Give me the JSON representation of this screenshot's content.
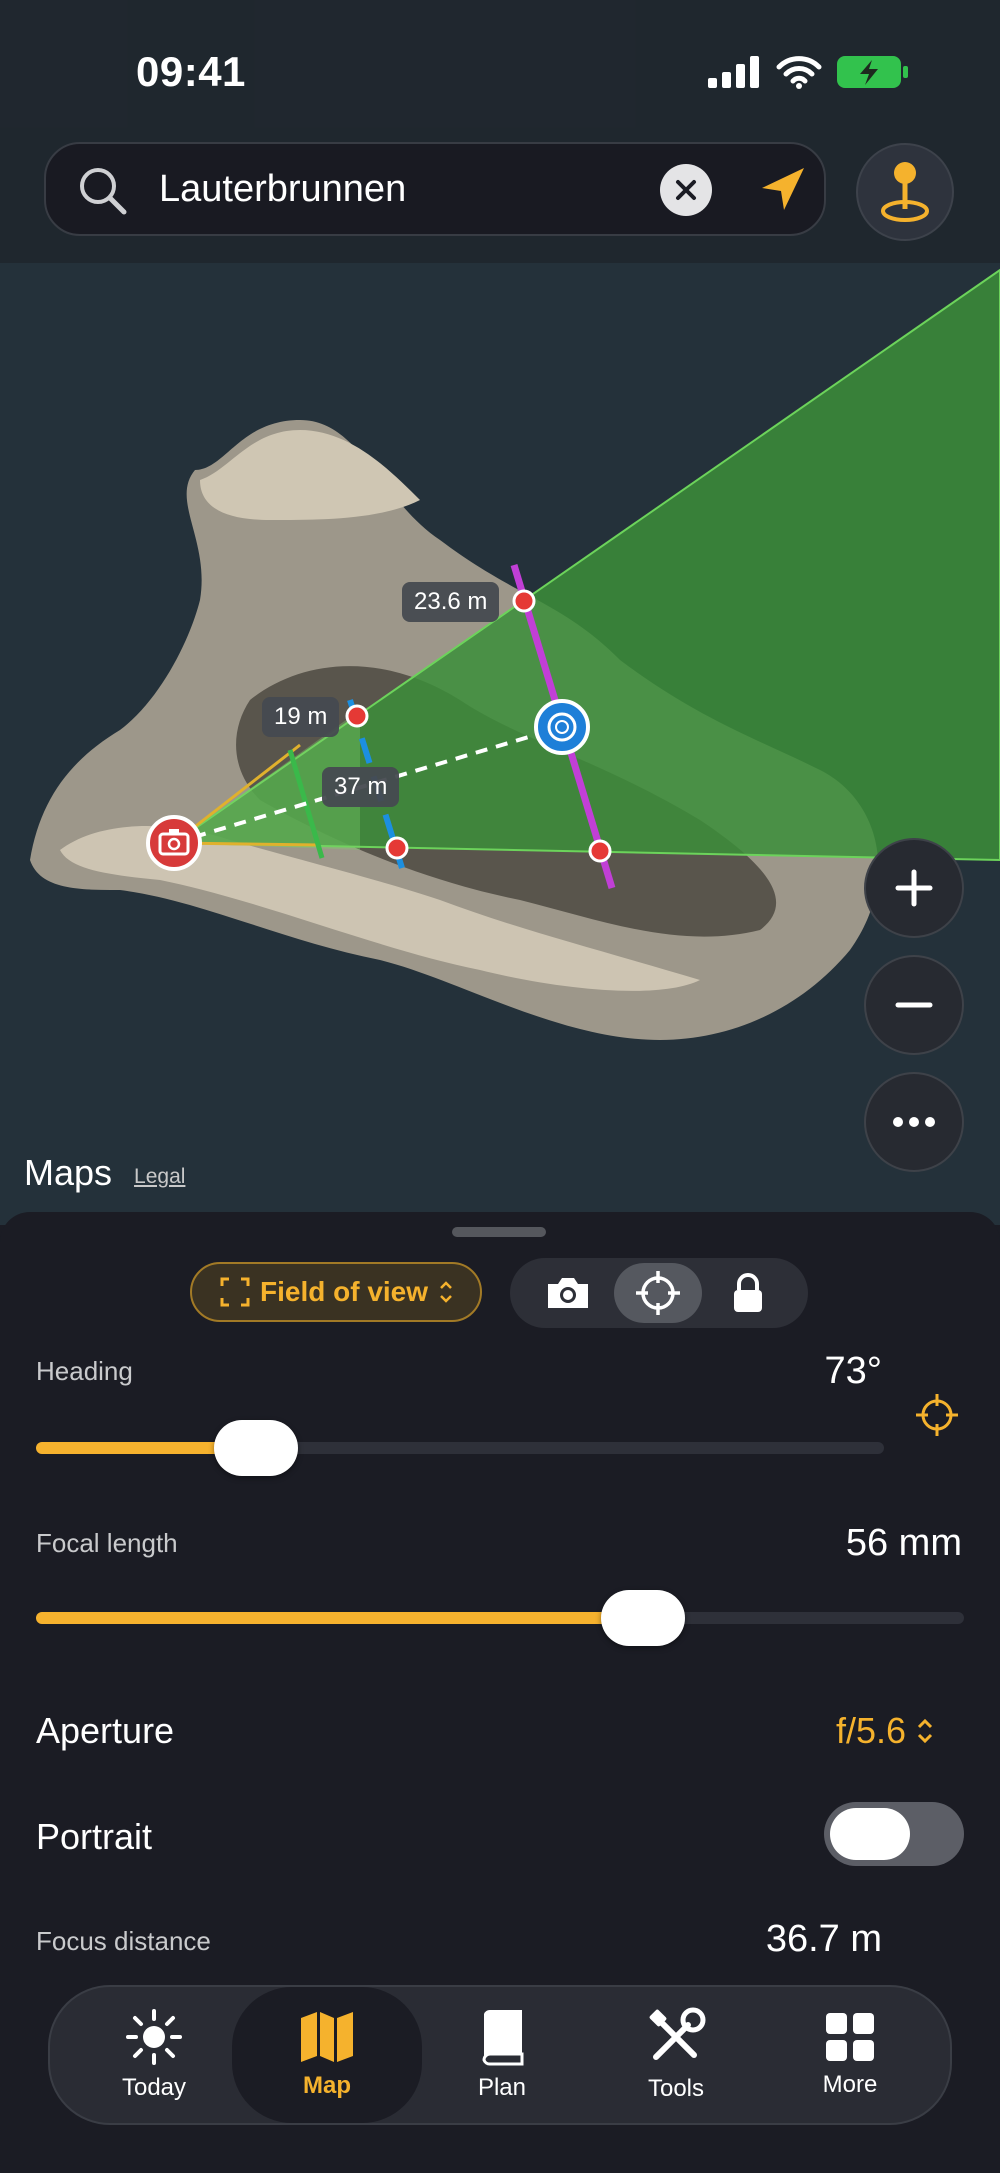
{
  "status_bar": {
    "time": "09:41"
  },
  "search": {
    "query": "Lauterbrunnen"
  },
  "map": {
    "labels": {
      "far": "23.6 m",
      "near": "19 m",
      "subject": "37 m"
    },
    "brand": "Maps",
    "legal": "Legal",
    "colors": {
      "field": "#3c8e3a",
      "accent": "#f5b22d",
      "focus_line": "#c13fd6",
      "dof_line": "#1c8fe0"
    }
  },
  "sheet": {
    "mode_pill": "Field of view",
    "heading": {
      "label": "Heading",
      "value": "73°",
      "fraction": 0.233
    },
    "focal_length": {
      "label": "Focal length",
      "value": "56 mm",
      "fraction": 0.67
    },
    "aperture": {
      "label": "Aperture",
      "value": "f/5.6"
    },
    "portrait": {
      "label": "Portrait",
      "on": false
    },
    "focus_distance": {
      "label": "Focus distance",
      "value": "36.7 m"
    }
  },
  "tabs": [
    {
      "label": "Today",
      "icon": "sun-icon"
    },
    {
      "label": "Map",
      "icon": "map-icon",
      "active": true
    },
    {
      "label": "Plan",
      "icon": "book-icon"
    },
    {
      "label": "Tools",
      "icon": "tools-icon"
    },
    {
      "label": "More",
      "icon": "grid-icon"
    }
  ]
}
